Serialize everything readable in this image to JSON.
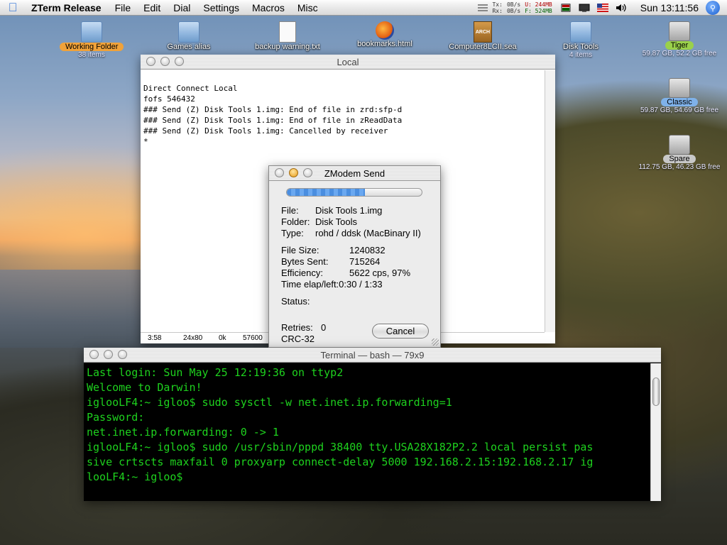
{
  "menubar": {
    "app_name": "ZTerm Release",
    "menus": [
      "File",
      "Edit",
      "Dial",
      "Settings",
      "Macros",
      "Misc"
    ],
    "net": {
      "tx_label": "Tx:",
      "rx_label": "Rx:",
      "tx_rate": "0B/s",
      "rx_rate": "0B/s",
      "u_mem": "U: 244MB",
      "f_mem": "F: 524MB"
    },
    "clock": "Sun 13:11:56"
  },
  "desktop": {
    "icons": [
      {
        "label": "Working Folder",
        "sub": "38 items"
      },
      {
        "label": "Games alias",
        "sub": ""
      },
      {
        "label": "backup warning.txt",
        "sub": ""
      },
      {
        "label": "bookmarks.html",
        "sub": ""
      },
      {
        "label": "Computer8LCII.sea",
        "sub": ""
      },
      {
        "label": "Disk Tools",
        "sub": "4 items"
      },
      {
        "label": "Tiger",
        "sub": "59.87 GB, 52.2 GB free"
      },
      {
        "label": "Classic",
        "sub": "59.87 GB, 54.69 GB free"
      },
      {
        "label": "Spare",
        "sub": "112.75 GB, 46.23 GB free"
      }
    ],
    "arch_label": "ARCH"
  },
  "local_window": {
    "title": "Local",
    "lines": [
      "Direct Connect Local",
      "fofs 546432",
      "### Send (Z) Disk Tools 1.img: End of file in zrd:sfp-d",
      "### Send (Z) Disk Tools 1.img: End of file in zReadData",
      "### Send (Z) Disk Tools 1.img: Cancelled by receiver",
      "*"
    ],
    "status": {
      "time": "3:58",
      "size": "24x80",
      "buffer": "0k",
      "baud": "57600"
    }
  },
  "zmodem": {
    "title": "ZModem Send",
    "progress": 0.58,
    "file_label": "File:",
    "file": "Disk Tools 1.img",
    "folder_label": "Folder:",
    "folder": "Disk Tools",
    "type_label": "Type:",
    "type": "rohd / ddsk (MacBinary II)",
    "size_label": "File Size:",
    "size": "1240832",
    "sent_label": "Bytes Sent:",
    "sent": "715264",
    "eff_label": "Efficiency:",
    "eff": "5622 cps, 97%",
    "time_label": "Time elap/left:",
    "time": "0:30 / 1:33",
    "status_label": "Status:",
    "status": "",
    "retries_label": "Retries:",
    "retries": "0",
    "crc": "CRC-32",
    "cancel_label": "Cancel"
  },
  "terminal": {
    "title": "Terminal — bash — 79x9",
    "lines": [
      "Last login: Sun May 25 12:19:36 on ttyp2",
      "Welcome to Darwin!",
      "iglooLF4:~ igloo$ sudo sysctl -w net.inet.ip.forwarding=1",
      "Password:",
      "net.inet.ip.forwarding: 0 -> 1",
      "iglooLF4:~ igloo$ sudo /usr/sbin/pppd 38400 tty.USA28X182P2.2 local persist pas",
      "sive crtscts maxfail 0 proxyarp connect-delay 5000 192.168.2.15:192.168.2.17 ig",
      "looLF4:~ igloo$"
    ]
  }
}
